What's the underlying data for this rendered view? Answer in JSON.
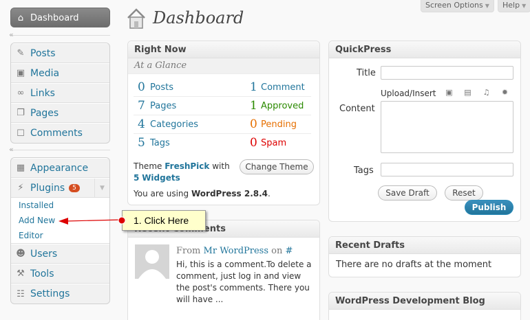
{
  "header": {
    "title": "Dashboard",
    "screen_options": "Screen Options",
    "help": "Help"
  },
  "sidebar": {
    "dashboard": "Dashboard",
    "group1": [
      "Posts",
      "Media",
      "Links",
      "Pages",
      "Comments"
    ],
    "appearance": "Appearance",
    "plugins": "Plugins",
    "plugins_badge": "5",
    "plugin_sub": [
      "Installed",
      "Add New",
      "Editor"
    ],
    "group3": [
      "Users",
      "Tools",
      "Settings"
    ]
  },
  "right_now": {
    "title": "Right Now",
    "subtitle": "At a Glance",
    "content": [
      {
        "num": "0",
        "label": "Posts"
      },
      {
        "num": "7",
        "label": "Pages"
      },
      {
        "num": "4",
        "label": "Categories"
      },
      {
        "num": "5",
        "label": "Tags"
      }
    ],
    "discussion": [
      {
        "num": "1",
        "label": "Comment"
      },
      {
        "num": "1",
        "label": "Approved"
      },
      {
        "num": "0",
        "label": "Pending"
      },
      {
        "num": "0",
        "label": "Spam"
      }
    ],
    "theme_prefix": "Theme",
    "theme_name": "FreshPick",
    "theme_with": "with",
    "widgets_count": "5",
    "widgets_label": "Widgets",
    "change_theme": "Change Theme",
    "version_prefix": "You are using",
    "version": "WordPress 2.8.4",
    "version_suffix": "."
  },
  "recent_comments": {
    "title": "Recent Comments",
    "from_label": "From",
    "author": "Mr WordPress",
    "on_label": "on",
    "post": "#",
    "text": "Hi, this is a comment.To delete a comment, just log in and view the post's comments. There you will have ..."
  },
  "quickpress": {
    "title": "QuickPress",
    "title_label": "Title",
    "upload_insert": "Upload/Insert",
    "content_label": "Content",
    "tags_label": "Tags",
    "save_draft": "Save Draft",
    "reset": "Reset",
    "publish": "Publish"
  },
  "recent_drafts": {
    "title": "Recent Drafts",
    "empty": "There are no drafts at the moment"
  },
  "dev_blog": {
    "title": "WordPress Development Blog"
  },
  "callout": {
    "text": "1. Click Here"
  },
  "colors": {
    "link": "#21759b",
    "approved": "#2b8a00",
    "pending": "#e66f00",
    "spam": "#dd0000",
    "callout_bg": "#ffffcc",
    "arrow": "#dd0000"
  }
}
